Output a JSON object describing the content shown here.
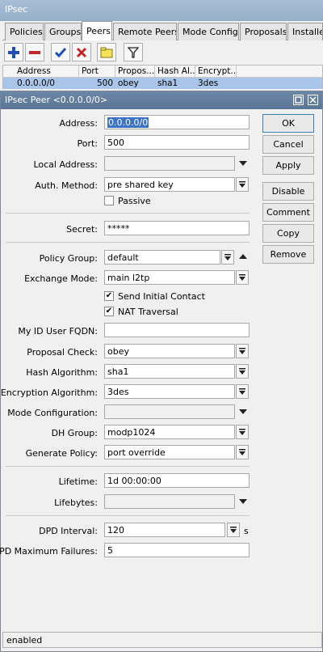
{
  "window": {
    "title": "IPsec"
  },
  "tabs": [
    "Policies",
    "Groups",
    "Peers",
    "Remote Peers",
    "Mode Configs",
    "Proposals",
    "Installed"
  ],
  "grid": {
    "headers": [
      "Address",
      "Port",
      "Propos...",
      "Hash Al...",
      "Encrypt..."
    ],
    "row": [
      "0.0.0.0/0",
      "500",
      "obey",
      "sha1",
      "3des"
    ]
  },
  "dialog": {
    "title": "IPsec Peer <0.0.0.0/0>",
    "labels": {
      "address": "Address:",
      "port": "Port:",
      "local_address": "Local Address:",
      "auth_method": "Auth. Method:",
      "passive": "Passive",
      "secret": "Secret:",
      "policy_group": "Policy Group:",
      "exchange_mode": "Exchange Mode:",
      "send_initial_contact": "Send Initial Contact",
      "nat_traversal": "NAT Traversal",
      "my_id_fqdn": "My ID User FQDN:",
      "proposal_check": "Proposal Check:",
      "hash_algorithm": "Hash Algorithm:",
      "encryption_algorithm": "Encryption Algorithm:",
      "mode_configuration": "Mode Configuration:",
      "dh_group": "DH Group:",
      "generate_policy": "Generate Policy:",
      "lifetime": "Lifetime:",
      "lifebytes": "Lifebytes:",
      "dpd_interval": "DPD Interval:",
      "dpd_max_failures": "DPD Maximum Failures:",
      "dpd_unit": "s"
    },
    "values": {
      "address": "0.0.0.0/0",
      "port": "500",
      "local_address": "",
      "auth_method": "pre shared key",
      "passive": false,
      "secret": "*****",
      "policy_group": "default",
      "exchange_mode": "main l2tp",
      "send_initial_contact": true,
      "nat_traversal": true,
      "my_id_fqdn": "",
      "proposal_check": "obey",
      "hash_algorithm": "sha1",
      "encryption_algorithm": "3des",
      "mode_configuration": "",
      "dh_group": "modp1024",
      "generate_policy": "port override",
      "lifetime": "1d 00:00:00",
      "lifebytes": "",
      "dpd_interval": "120",
      "dpd_max_failures": "5"
    },
    "buttons": [
      "OK",
      "Cancel",
      "Apply",
      "Disable",
      "Comment",
      "Copy",
      "Remove"
    ]
  },
  "status": "enabled",
  "colors": {
    "selection": "#a9c6ea",
    "titlebar": "#6c87a7",
    "add_icon": "#1f4fb5",
    "remove_icon": "#c0282a"
  }
}
